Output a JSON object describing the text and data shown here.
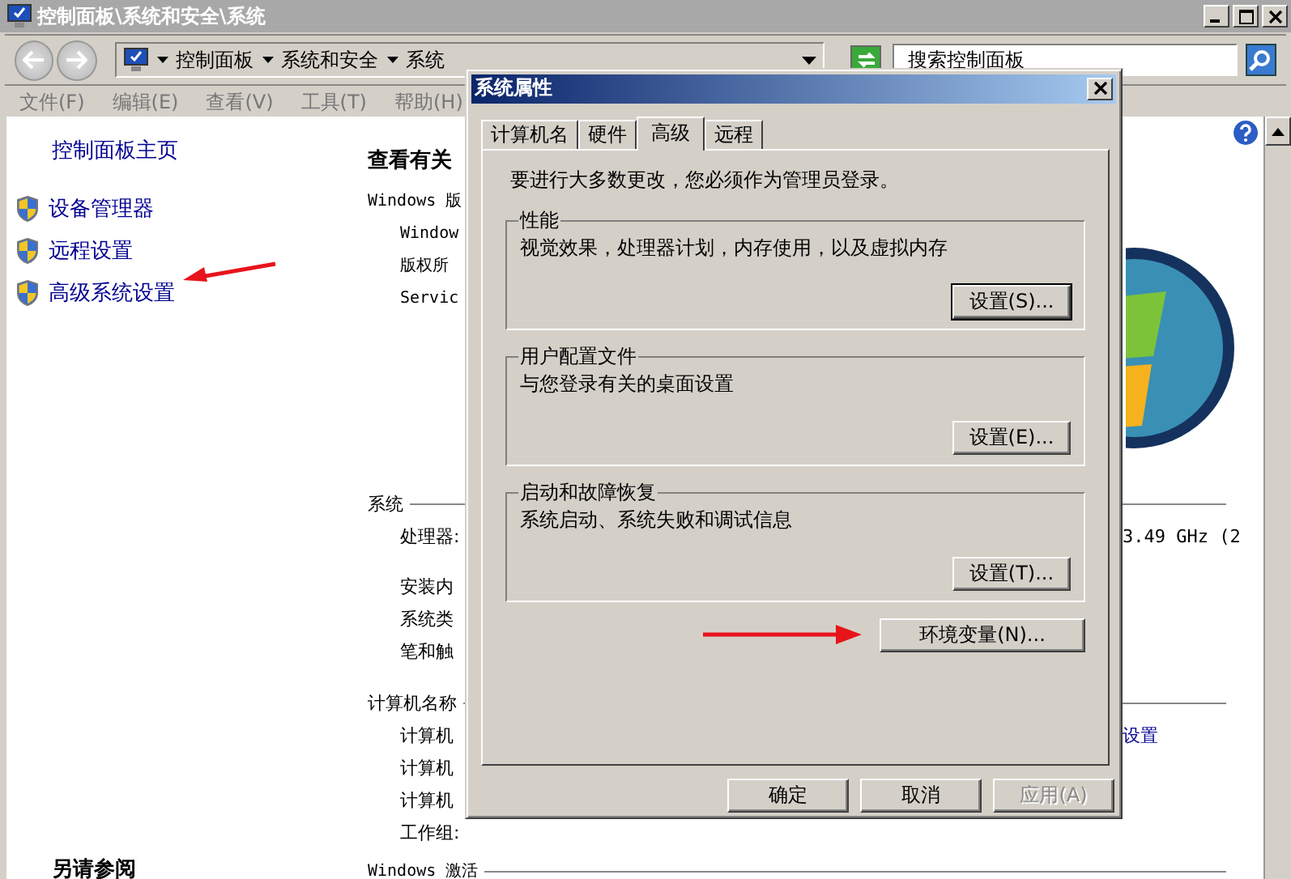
{
  "window": {
    "title": "控制面板\\系统和安全\\系统"
  },
  "address_bar": {
    "crumbs": [
      "控制面板",
      "系统和安全",
      "系统"
    ]
  },
  "search": {
    "placeholder": "搜索控制面板"
  },
  "menu": [
    "文件(F)",
    "编辑(E)",
    "查看(V)",
    "工具(T)",
    "帮助(H)"
  ],
  "sidebar": {
    "home": "控制面板主页",
    "links": [
      "设备管理器",
      "远程设置",
      "高级系统设置"
    ],
    "see_also": "另请参阅"
  },
  "main": {
    "heading": "查看有关",
    "sections": [
      {
        "kind": "plain",
        "title": "Windows 版",
        "rows": [
          {
            "label": "Window"
          },
          {
            "label": "版权所"
          },
          {
            "label": "Servic"
          }
        ]
      },
      {
        "kind": "ruled",
        "title": "系统",
        "rows": [
          {
            "label": "处理器:",
            "value": "3.49 GHz   (2"
          },
          {
            "label": "安装内"
          },
          {
            "label": "系统类"
          },
          {
            "label": "笔和触"
          }
        ]
      },
      {
        "kind": "ruled",
        "title": "计算机名称",
        "rows": [
          {
            "label": "计算机",
            "link": "设置"
          },
          {
            "label": "计算机"
          },
          {
            "label": "计算机"
          },
          {
            "label": "工作组:"
          }
        ]
      },
      {
        "kind": "ruled",
        "title": "Windows 激活"
      }
    ]
  },
  "dialog": {
    "title": "系统属性",
    "tabs": [
      {
        "label": "计算机名",
        "selected": false
      },
      {
        "label": "硬件",
        "selected": false
      },
      {
        "label": "高级",
        "selected": true
      },
      {
        "label": "远程",
        "selected": false
      }
    ],
    "note": "要进行大多数更改，您必须作为管理员登录。",
    "groups": [
      {
        "title": "性能",
        "text": "视觉效果，处理器计划，内存使用，以及虚拟内存",
        "button": "设置(S)...",
        "focused": true
      },
      {
        "title": "用户配置文件",
        "text": "与您登录有关的桌面设置",
        "button": "设置(E)...",
        "focused": false
      },
      {
        "title": "启动和故障恢复",
        "text": "系统启动、系统失败和调试信息",
        "button": "设置(T)...",
        "focused": false
      }
    ],
    "env_button": "环境变量(N)...",
    "buttons": [
      {
        "label": "确定",
        "disabled": false
      },
      {
        "label": "取消",
        "disabled": false
      },
      {
        "label": "应用(A)",
        "disabled": true
      }
    ]
  }
}
